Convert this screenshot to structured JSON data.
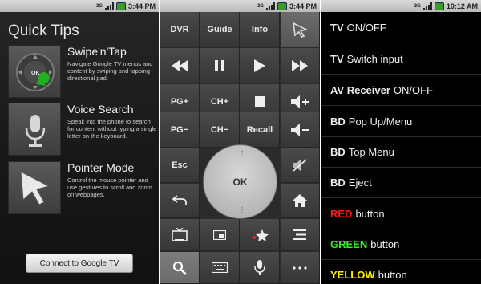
{
  "status": [
    {
      "network": "3G",
      "time": "3:44 PM"
    },
    {
      "network": "3G",
      "time": "3:44 PM"
    },
    {
      "network": "3G",
      "time": "10:12 AM"
    }
  ],
  "quick_tips": {
    "title": "Quick Tips",
    "tips": [
      {
        "title": "Swipe'n'Tap",
        "desc": "Navigate Google TV menus and content by swiping and tapping directional pad.",
        "icon": "swipe-tap-icon",
        "icon_label": "OK"
      },
      {
        "title": "Voice Search",
        "desc": "Speak into the phone to search for content without typing a single letter on the keyboard.",
        "icon": "microphone-icon"
      },
      {
        "title": "Pointer Mode",
        "desc": "Control the mouse pointer and use gestures to scroll and zoom on webpages.",
        "icon": "pointer-icon"
      }
    ],
    "connect_button": "Connect to Google TV"
  },
  "remote": {
    "row1": [
      "DVR",
      "Guide",
      "Info"
    ],
    "pg_up": "PG+",
    "ch_up": "CH+",
    "pg_down": "PG−",
    "ch_down": "CH−",
    "recall": "Recall",
    "esc": "Esc",
    "ok": "OK"
  },
  "commands": [
    {
      "bold": "TV",
      "text": "ON/OFF",
      "color": "#ececec"
    },
    {
      "bold": "TV",
      "text": "Switch input",
      "color": "#ececec"
    },
    {
      "bold": "AV Receiver",
      "text": "ON/OFF",
      "color": "#ececec"
    },
    {
      "bold": "BD",
      "text": "Pop Up/Menu",
      "color": "#ececec"
    },
    {
      "bold": "BD",
      "text": "Top Menu",
      "color": "#ececec"
    },
    {
      "bold": "BD",
      "text": "Eject",
      "color": "#ececec"
    },
    {
      "bold": "RED",
      "text": "button",
      "color": "#ff1a1a"
    },
    {
      "bold": "GREEN",
      "text": "button",
      "color": "#33ee22"
    },
    {
      "bold": "YELLOW",
      "text": "button",
      "color": "#ffee00"
    }
  ]
}
